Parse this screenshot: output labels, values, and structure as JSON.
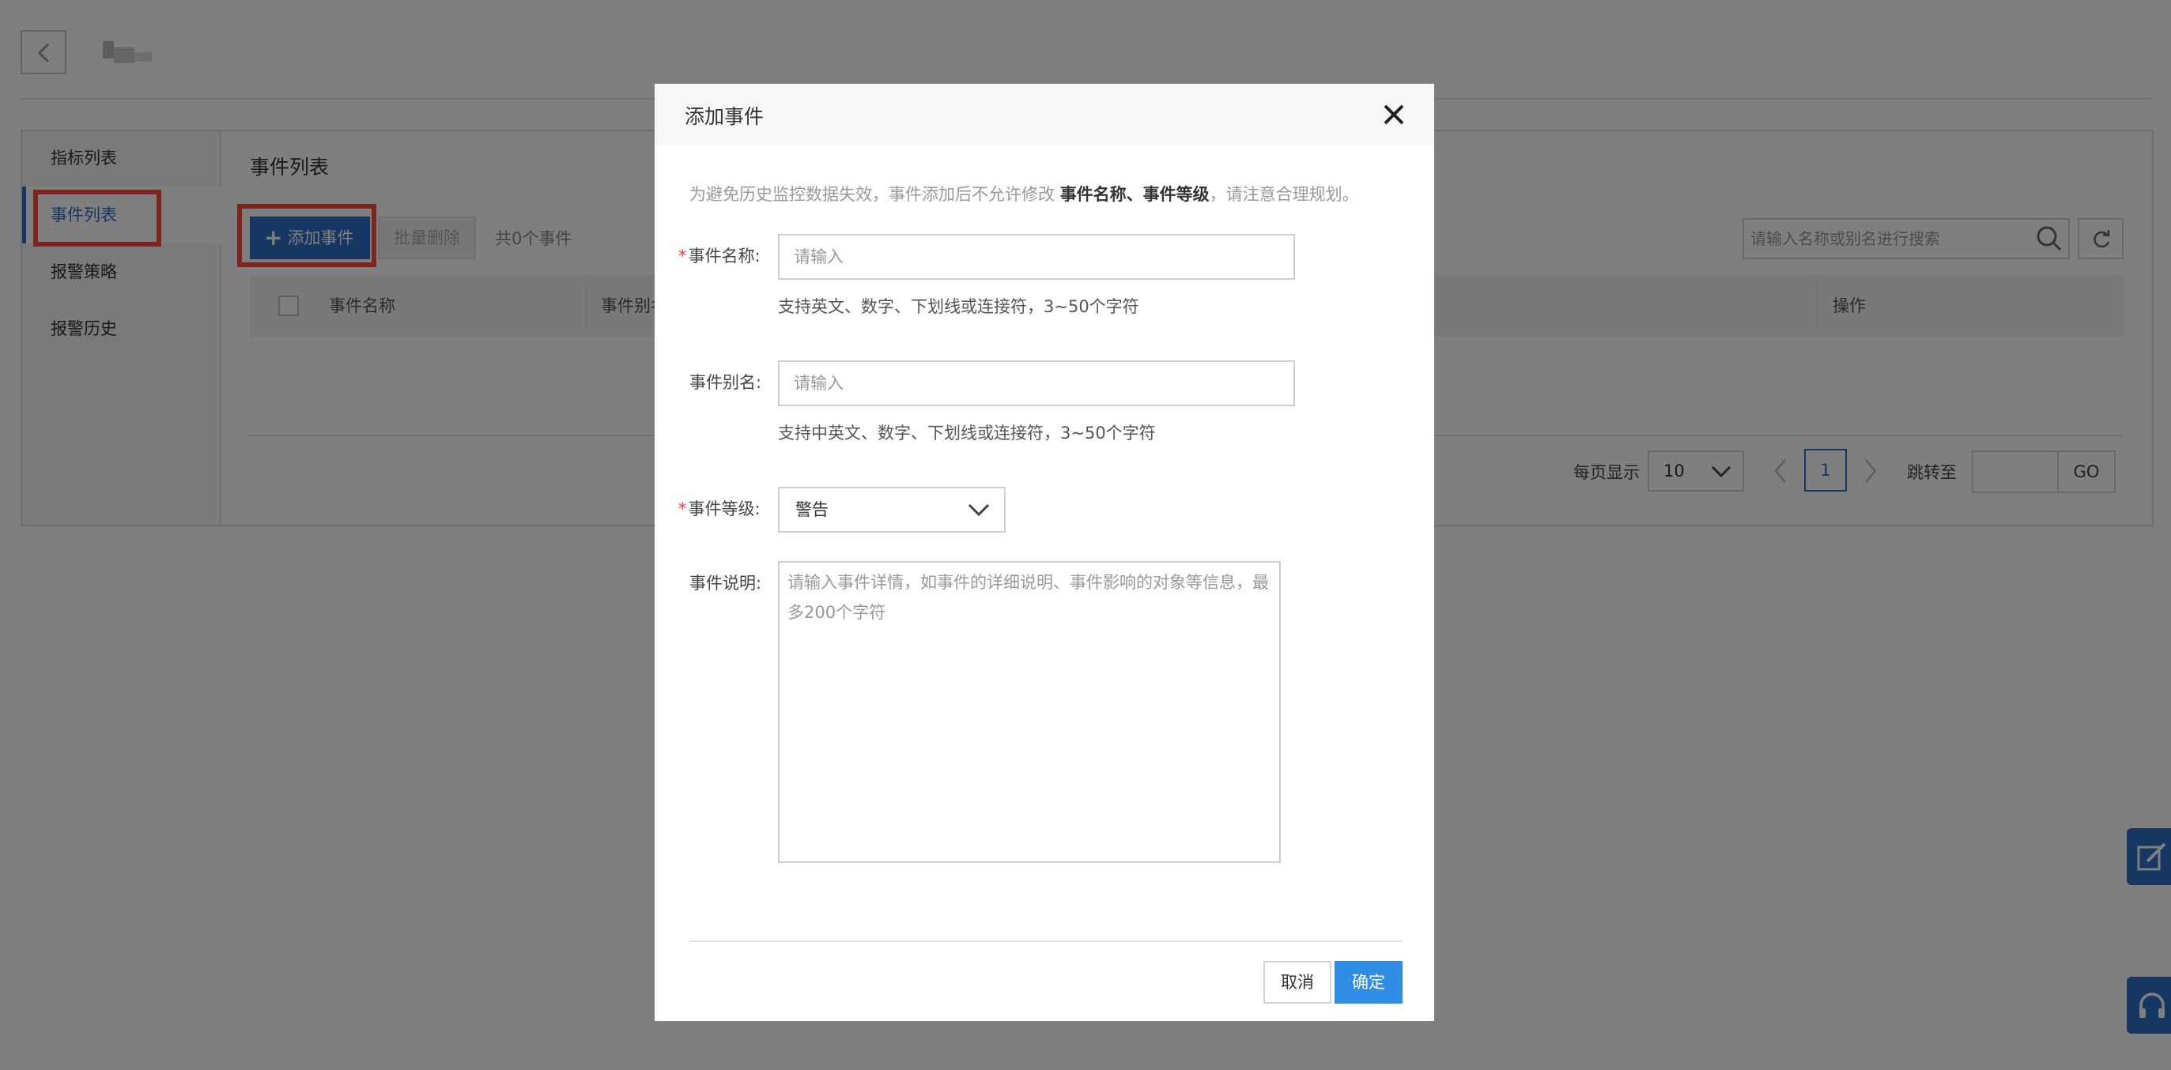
{
  "sidebar": {
    "items": [
      {
        "label": "指标列表"
      },
      {
        "label": "事件列表"
      },
      {
        "label": "报警策略"
      },
      {
        "label": "报警历史"
      }
    ],
    "active_index": 1
  },
  "main": {
    "title": "事件列表",
    "add_label": "添加事件",
    "batch_delete_label": "批量删除",
    "count_text": "共0个事件",
    "search_placeholder": "请输入名称或别名进行搜索",
    "columns": [
      "事件名称",
      "事件别名",
      "操作"
    ]
  },
  "pagination": {
    "per_page_label": "每页显示",
    "per_page_value": "10",
    "current_page": "1",
    "jump_label": "跳转至",
    "go_label": "GO"
  },
  "dialog": {
    "title": "添加事件",
    "notice_prefix": "为避免历史监控数据失效，事件添加后不允许修改",
    "notice_bold": "事件名称、事件等级",
    "notice_suffix": "，请注意合理规划。",
    "required_mark": "*",
    "fields": {
      "name": {
        "label": "事件名称:",
        "placeholder": "请输入",
        "hint": "支持英文、数字、下划线或连接符，3~50个字符"
      },
      "alias": {
        "label": "事件别名:",
        "placeholder": "请输入",
        "hint": "支持中英文、数字、下划线或连接符，3~50个字符"
      },
      "level": {
        "label": "事件等级:",
        "value": "警告"
      },
      "description": {
        "label": "事件说明:",
        "placeholder": "请输入事件详情，如事件的详细说明、事件影响的对象等信息，最多200个字符"
      }
    },
    "cancel_label": "取消",
    "ok_label": "确定"
  },
  "colors": {
    "primary": "#2b6fc2",
    "highlight": "#ff4a3d",
    "ok_button": "#2f8de6",
    "required": "#ff3a30"
  },
  "icons": {
    "back": "chevron-left-icon",
    "search": "search-icon",
    "refresh": "refresh-icon",
    "close": "close-icon",
    "dropdown": "chevron-down-icon",
    "float_top": "edit-icon",
    "float_bottom": "headset-icon"
  }
}
